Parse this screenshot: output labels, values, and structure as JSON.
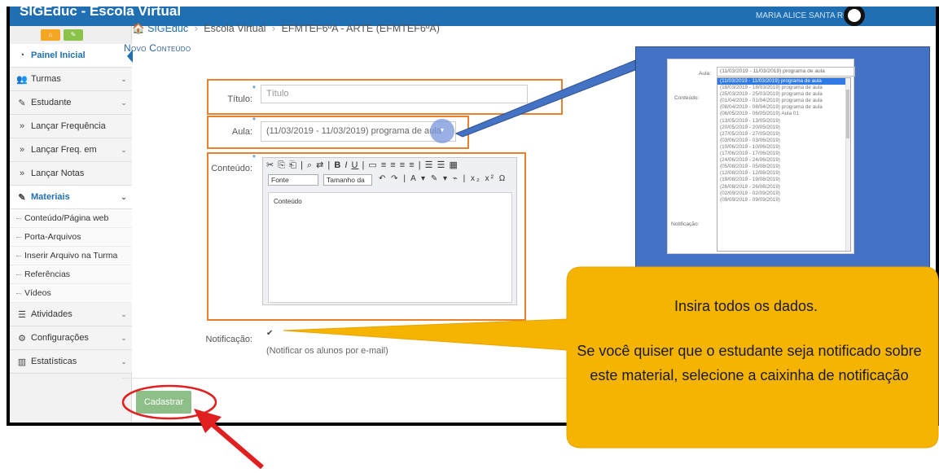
{
  "app": {
    "title": "SIGEduc - Escola Virtual",
    "user_name": "MARIA ALICE SANTA ROSA"
  },
  "sidebar": {
    "items": [
      {
        "label": "Painel Inicial",
        "icon": "dashboard-icon"
      },
      {
        "label": "Turmas",
        "icon": "users-icon"
      },
      {
        "label": "Estudante",
        "icon": "edit-icon"
      },
      {
        "label": "Lançar Frequência",
        "icon": "double-chevron-icon"
      },
      {
        "label": "Lançar Freq. em",
        "icon": "double-chevron-icon"
      },
      {
        "label": "Lançar Notas",
        "icon": "double-chevron-icon"
      },
      {
        "label": "Materiais",
        "icon": "edit-icon"
      }
    ],
    "materiais_sub": [
      "Conteúdo/Página web",
      "Porta-Arquivos",
      "Inserir Arquivo na Turma",
      "Referências",
      "Vídeos"
    ],
    "bottom_items": [
      {
        "label": "Atividades",
        "icon": "list-icon"
      },
      {
        "label": "Configurações",
        "icon": "gears-icon"
      },
      {
        "label": "Estatísticas",
        "icon": "bar-chart-icon"
      }
    ]
  },
  "breadcrumb": {
    "home": "SIGEduc",
    "level1": "Escola Virtual",
    "level2": "EFMTEF6ºA - ARTE (EFMTEF6ºA)"
  },
  "page": {
    "title": "Novo Conteúdo"
  },
  "form": {
    "titulo_label": "Título:",
    "titulo_placeholder": "Título",
    "aula_label": "Aula:",
    "aula_value": "(11/03/2019 - 11/03/2019) programa de aula",
    "conteudo_label": "Conteúdo:",
    "editor_font": "Fonte",
    "editor_size": "Tamanho da",
    "editor_text": "Conteúdo",
    "notificacao_label": "Notificação:",
    "notificacao_desc": "(Notificar os alunos por e-mail)",
    "submit_label": "Cadastrar"
  },
  "callout_zoom": {
    "aula_label": "Aula:",
    "conteudo_label": "Conteúdo:",
    "notificacao_label": "Notificação:",
    "selected_value": "(11/03/2019 - 11/03/2019) programa de aula",
    "options": [
      "(11/03/2019 - 11/03/2019) programa de aula",
      "(18/03/2019 - 18/03/2019) programa de aula",
      "(25/03/2019 - 25/03/2019) programa de aula",
      "(01/04/2019 - 01/04/2019) programa de aula",
      "(08/04/2019 - 08/04/2019) programa de aula",
      "(06/05/2019 - 06/05/2019) Aula 01",
      "(13/05/2019 - 13/05/2019)",
      "(20/05/2019 - 20/05/2019)",
      "(27/05/2019 - 27/05/2019)",
      "(03/06/2019 - 03/06/2019)",
      "(10/06/2019 - 10/06/2019)",
      "(17/06/2019 - 17/06/2019)",
      "(24/06/2019 - 24/06/2019)",
      "(05/08/2019 - 05/08/2019)",
      "(12/08/2019 - 12/08/2019)",
      "(19/08/2019 - 19/08/2019)",
      "(26/08/2019 - 26/08/2019)",
      "(02/09/2019 - 02/09/2019)",
      "(09/09/2019 - 09/09/2019)"
    ]
  },
  "bubble": {
    "line1": "Insira todos os dados.",
    "line2": "Se você quiser que o estudante seja notificado sobre este material, selecione a caixinha de notificação"
  },
  "colors": {
    "brand_blue": "#1f6fb2",
    "highlight_orange": "#e8812f",
    "bubble_yellow": "#f5b400",
    "submit_green": "#8fbf88",
    "arrow_red": "#e02020"
  }
}
